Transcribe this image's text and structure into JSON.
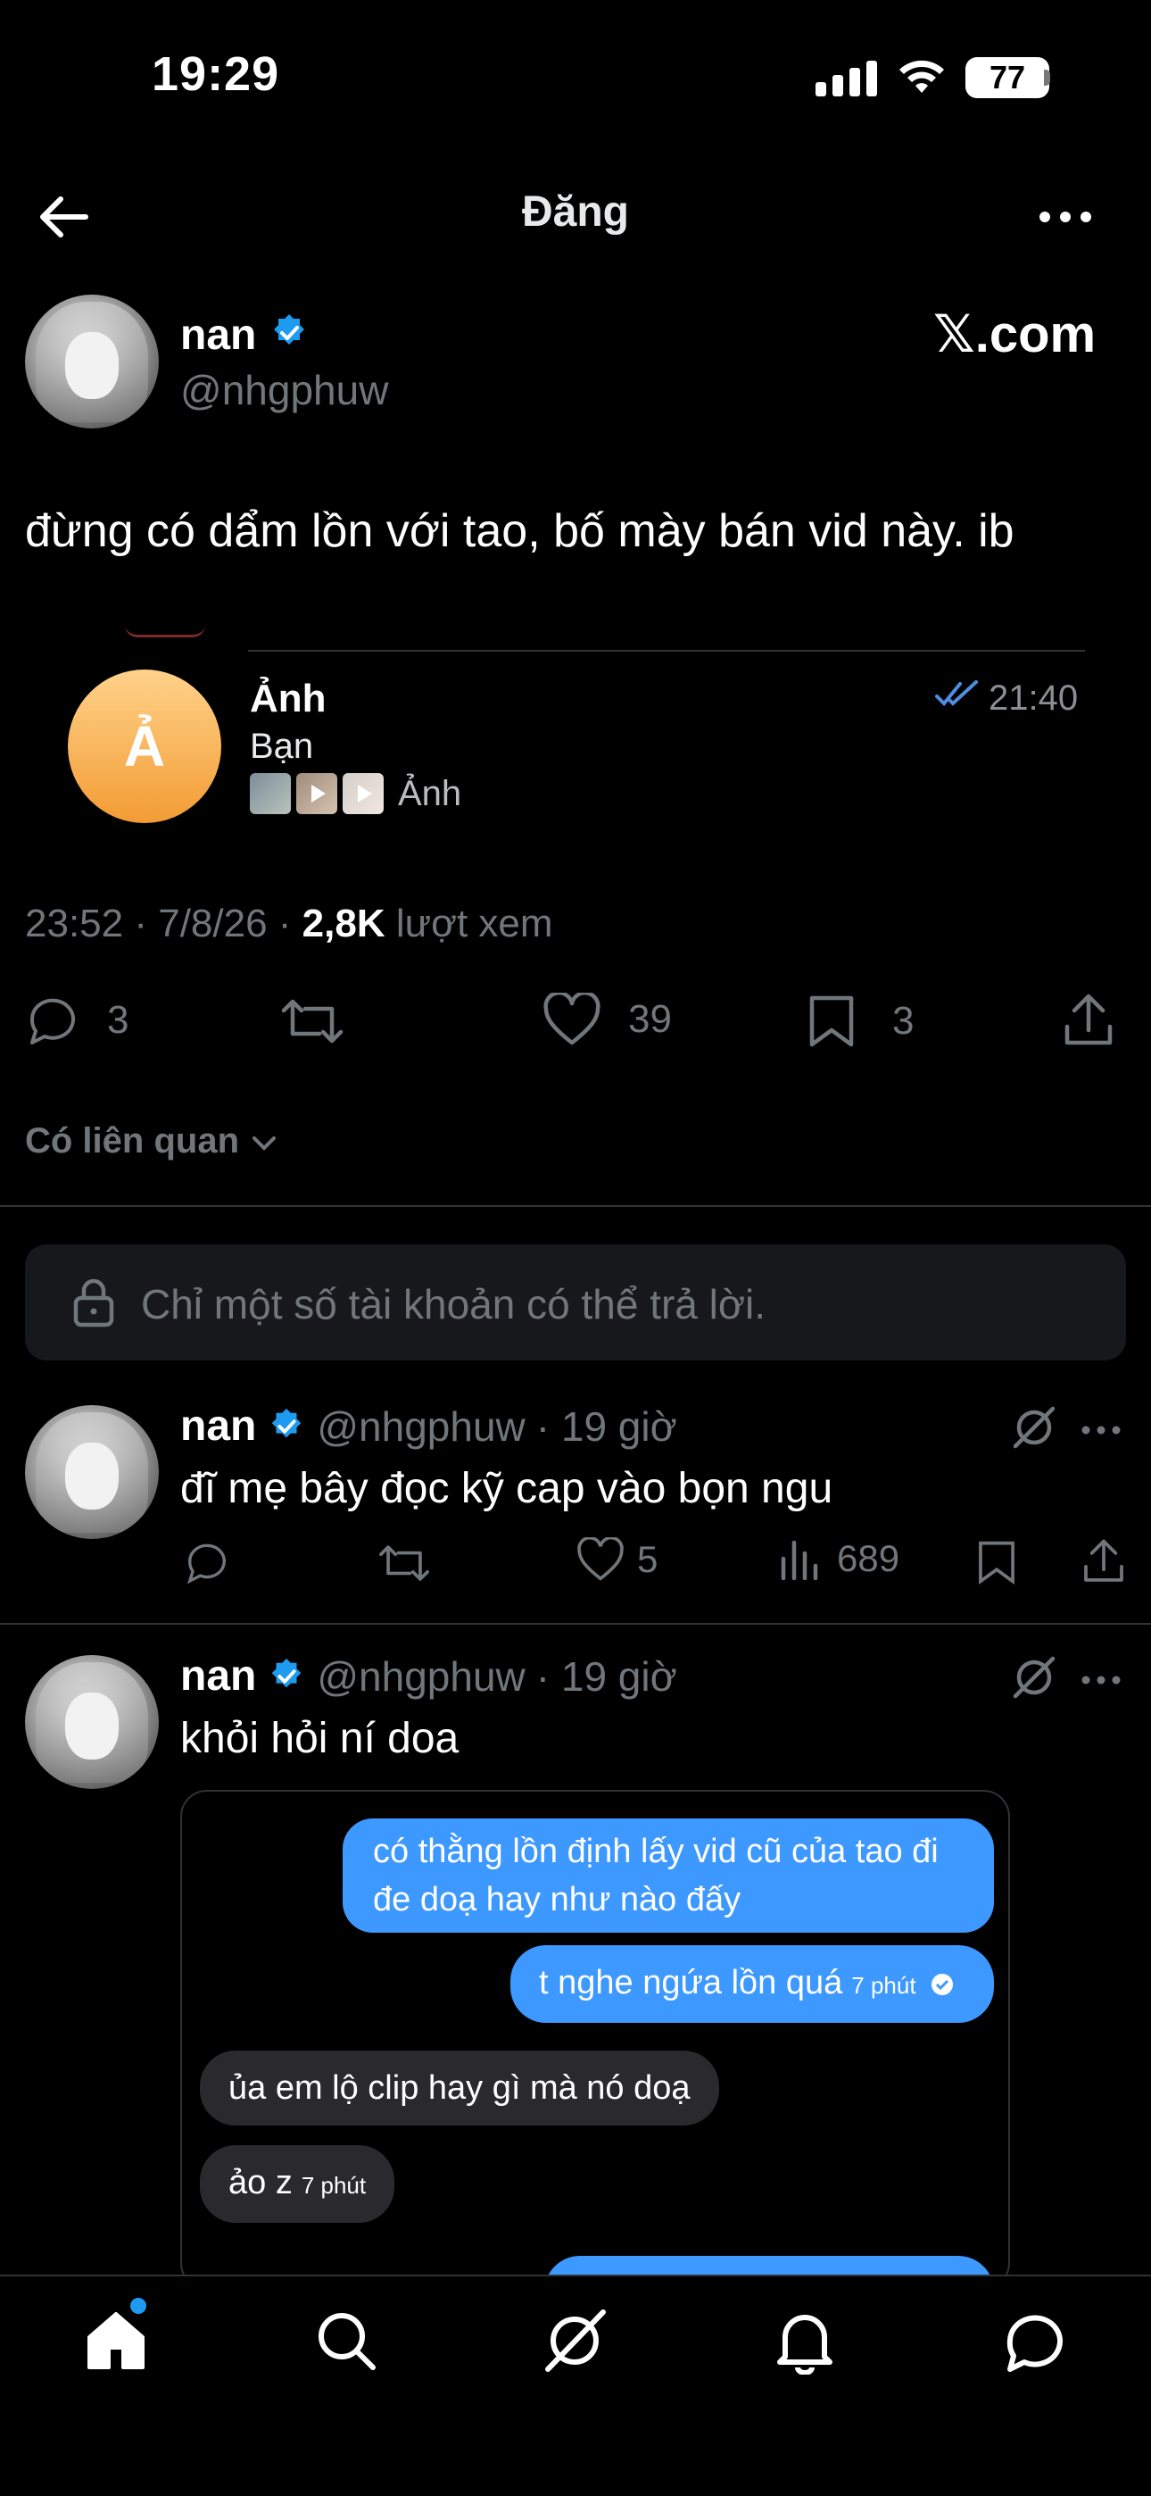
{
  "status_bar": {
    "time": "19:29",
    "battery": "77"
  },
  "header": {
    "title": "Đăng"
  },
  "post": {
    "author_name": "nan",
    "author_handle": "@nhgphuw",
    "source_label": "𝕏.com",
    "text": "đừng có dẩm lồn với tao, bố mày bán vid này. ib",
    "embedded_chat": {
      "avatar_letter": "Ả",
      "title": "Ảnh",
      "subtitle": "Bạn",
      "preview_label": "Ảnh",
      "time": "21:40"
    },
    "meta": {
      "time": "23:52",
      "date": "7/8/26",
      "views": "2,8K",
      "views_label": "lượt xem"
    },
    "counts": {
      "replies": "3",
      "likes": "39",
      "bookmarks": "3"
    }
  },
  "related_label": "Có liên quan",
  "reply_restriction": "Chỉ một số tài khoản có thể trả lời.",
  "replies": [
    {
      "name": "nan",
      "handle": "@nhgphuw",
      "time": "· 19 giờ",
      "text": "đĩ mẹ bây đọc kỹ cap vào bọn ngu",
      "likes": "5",
      "views": "689"
    },
    {
      "name": "nan",
      "handle": "@nhgphuw",
      "time": "· 19 giờ",
      "text": "khỏi hỏi ní doa",
      "chat": [
        {
          "line1": "có thằng lồn định lấy vid cũ của tao đi",
          "line2": "đe doạ hay như nào đấy"
        },
        {
          "text": "t nghe ngứa lồn quá",
          "time": "7 phút"
        },
        {
          "text": "ủa em lộ clip hay gì mà nó doạ"
        },
        {
          "text": "ảo z",
          "time": "7 phút"
        }
      ]
    }
  ],
  "colors": {
    "background": "#000000",
    "accent": "#1d9bf0",
    "muted": "#71767b",
    "divider": "#2f3336",
    "bubble_blue": "#3d98ff"
  },
  "nav": [
    "home-icon",
    "search-icon",
    "grok-icon",
    "bell-icon",
    "messages-icon"
  ]
}
